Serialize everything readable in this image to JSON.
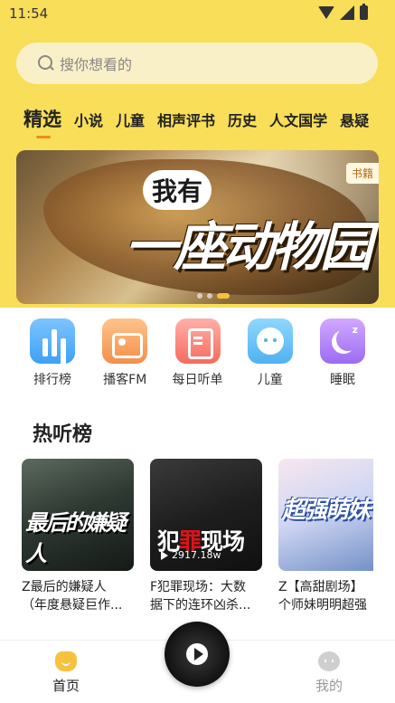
{
  "status_bar": {
    "time": "11:54"
  },
  "search": {
    "placeholder": "搜你想看的"
  },
  "tabs": [
    {
      "label": "精选",
      "active": true
    },
    {
      "label": "小说"
    },
    {
      "label": "儿童"
    },
    {
      "label": "相声评书"
    },
    {
      "label": "历史"
    },
    {
      "label": "人文国学"
    },
    {
      "label": "悬疑"
    }
  ],
  "banner": {
    "title_line1": "我有",
    "title_line2": "一座动物园",
    "tag": "书籍",
    "dots_count": 3,
    "active_dot": 2
  },
  "quick_nav": [
    {
      "label": "排行榜",
      "icon": "ranking-icon"
    },
    {
      "label": "播客FM",
      "icon": "radio-icon"
    },
    {
      "label": "每日听单",
      "icon": "daily-list-icon"
    },
    {
      "label": "儿童",
      "icon": "kid-face-icon"
    },
    {
      "label": "睡眠",
      "icon": "moon-icon"
    }
  ],
  "hot_section": {
    "title": "热听榜",
    "items": [
      {
        "cover_text": "最后的嫌疑人",
        "title_line1": "Z最后的嫌疑人",
        "title_line2": "（年度悬疑巨作..."
      },
      {
        "cover_text_a": "犯",
        "cover_text_b": "罪",
        "cover_text_c": "现场",
        "plays": "2917.18w",
        "title_line1": "F犯罪现场：大数",
        "title_line2": "据下的连环凶杀..."
      },
      {
        "cover_text": "超强萌妹",
        "title_line1": "Z【高甜剧场】",
        "title_line2": "个师妹明明超强"
      }
    ]
  },
  "bottom_nav": {
    "home_label": "首页",
    "me_label": "我的"
  },
  "colors": {
    "header_yellow": "#f8de59",
    "accent_orange": "#f08a24"
  }
}
